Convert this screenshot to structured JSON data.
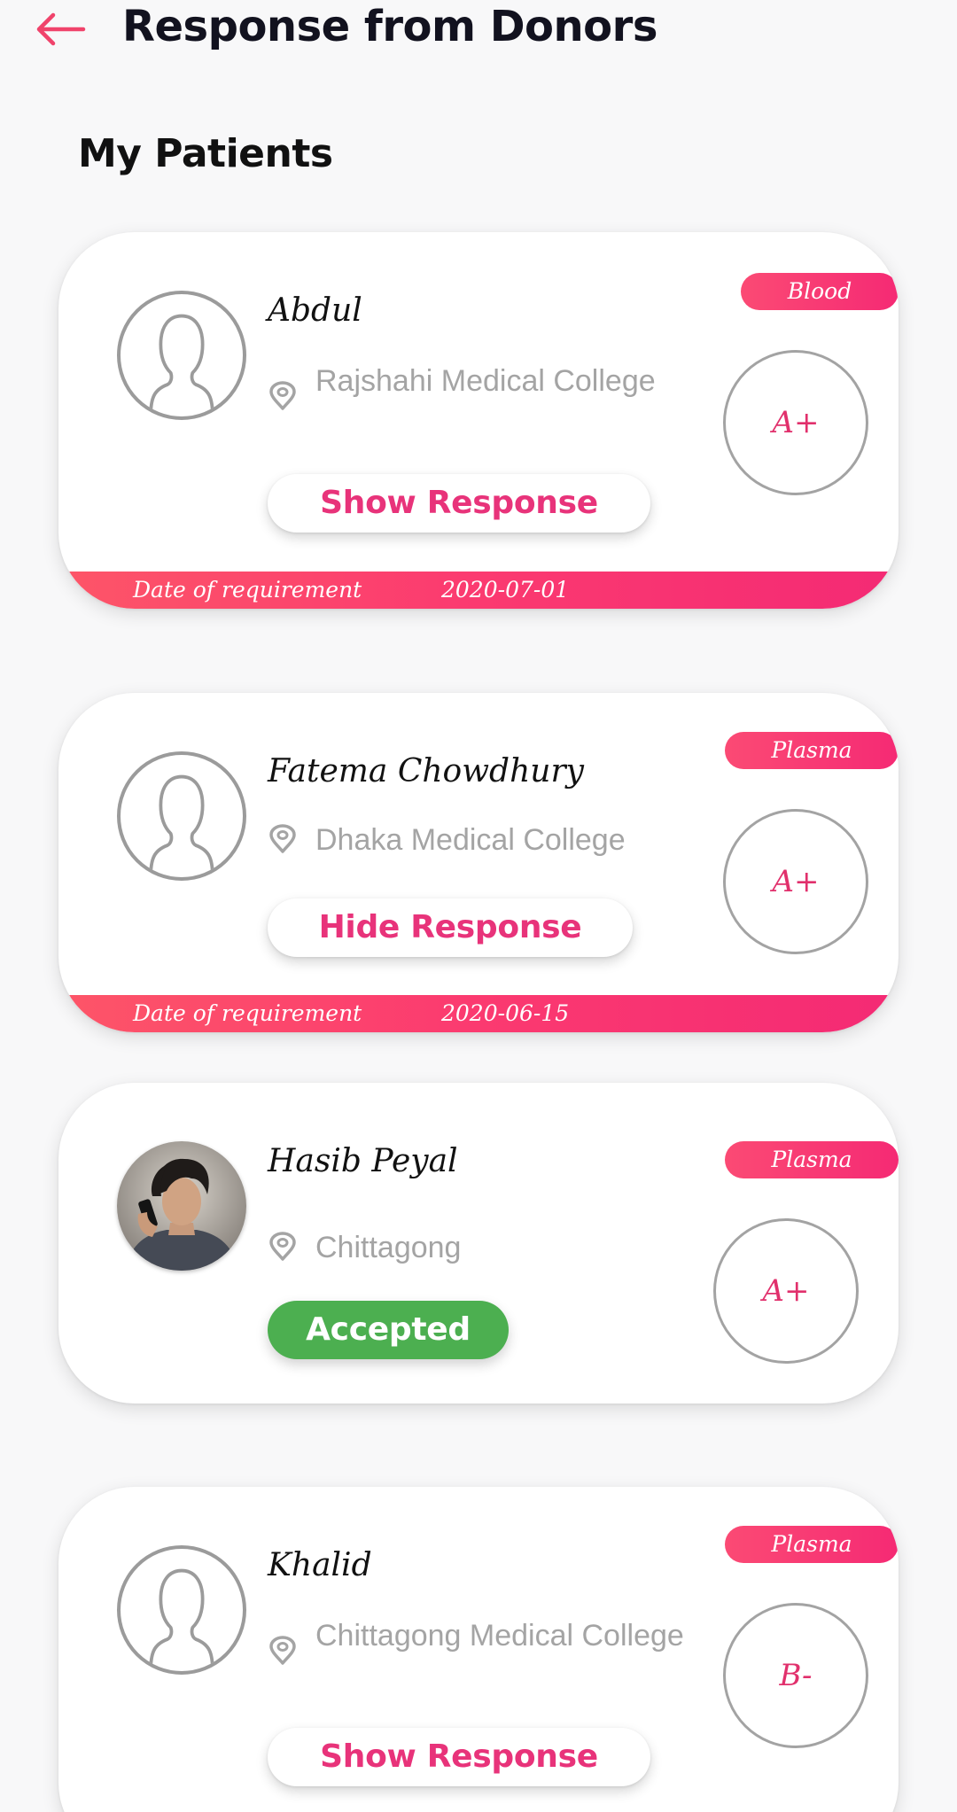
{
  "header": {
    "title": "Response from Donors"
  },
  "section": {
    "title": "My Patients"
  },
  "colors": {
    "accent": "#e8337a",
    "badge_gradient_start": "#fb4a74",
    "badge_gradient_end": "#f52a74",
    "accepted_green": "#4caf50"
  },
  "patients": [
    {
      "name": "Abdul",
      "location": "Rajshahi Medical College",
      "donation_type": "Blood",
      "blood_group": "A+",
      "action_label": "Show Response",
      "avatar": "default-person-icon",
      "date_label": "Date of requirement",
      "date": "2020-07-01"
    },
    {
      "name": "Fatema Chowdhury",
      "location": "Dhaka Medical College",
      "donation_type": "Plasma",
      "blood_group": "A+",
      "action_label": "Hide Response",
      "avatar": "default-person-icon",
      "date_label": "Date of requirement",
      "date": "2020-06-15"
    },
    {
      "name": "Hasib Peyal",
      "location": "Chittagong",
      "donation_type": "Plasma",
      "blood_group": "A+",
      "action_label": "Accepted",
      "avatar": "user-photo"
    },
    {
      "name": "Khalid",
      "location": "Chittagong Medical College",
      "donation_type": "Plasma",
      "blood_group": "B-",
      "action_label": "Show Response",
      "avatar": "default-person-icon"
    }
  ]
}
